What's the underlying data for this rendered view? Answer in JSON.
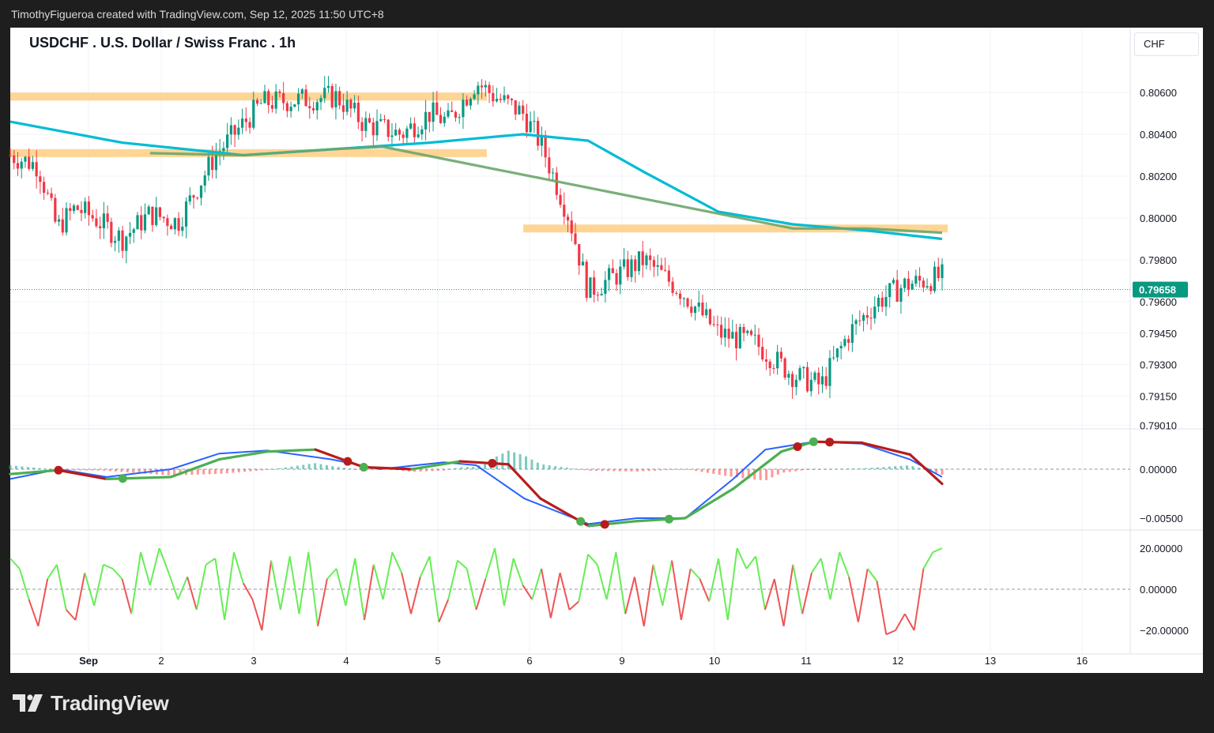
{
  "header": {
    "attribution": "TimothyFigueroa created with TradingView.com, Sep 12, 2025 11:50 UTC+8"
  },
  "chart_header": {
    "symbol_line": "USDCHF . U.S. Dollar / Swiss Franc . 1h",
    "currency_button": "CHF"
  },
  "footer": {
    "brand": "TradingView"
  },
  "colors": {
    "up": "#089981",
    "down": "#f23645",
    "ma_long": "#00bcd4",
    "ma_short": "#6aa66a",
    "zone": "#ffd08a",
    "macd": "#2962ff",
    "signal_up": "#4caf50",
    "signal_down": "#b71c1c",
    "osc_up": "#66ee55",
    "osc_down": "#ee5555"
  },
  "chart_data": [
    {
      "type": "candlestick",
      "title": "USDCHF . U.S. Dollar / Swiss Franc . 1h",
      "x_ticks": [
        "Sep",
        "2",
        "3",
        "4",
        "5",
        "6",
        "9",
        "10",
        "11",
        "12",
        "13",
        "16"
      ],
      "y_ticks": [
        "0.80600",
        "0.80400",
        "0.80200",
        "0.80000",
        "0.79800",
        "0.79600",
        "0.79450",
        "0.79300",
        "0.79150",
        "0.79010"
      ],
      "last_price": "0.79658",
      "close_path": [
        [
          0,
          0.803
        ],
        [
          0.03,
          0.8025
        ],
        [
          0.05,
          0.7995
        ],
        [
          0.07,
          0.8005
        ],
        [
          0.09,
          0.8
        ],
        [
          0.12,
          0.799
        ],
        [
          0.15,
          0.8002
        ],
        [
          0.18,
          0.7998
        ],
        [
          0.22,
          0.803
        ],
        [
          0.27,
          0.8055
        ],
        [
          0.35,
          0.8058
        ],
        [
          0.38,
          0.8045
        ],
        [
          0.42,
          0.804
        ],
        [
          0.45,
          0.805
        ],
        [
          0.47,
          0.8046
        ],
        [
          0.5,
          0.8065
        ],
        [
          0.52,
          0.8058
        ],
        [
          0.55,
          0.805
        ],
        [
          0.57,
          0.8035
        ],
        [
          0.6,
          0.8
        ],
        [
          0.62,
          0.7965
        ],
        [
          0.68,
          0.798
        ],
        [
          0.72,
          0.7965
        ],
        [
          0.76,
          0.7945
        ],
        [
          0.8,
          0.794
        ],
        [
          0.84,
          0.7925
        ],
        [
          0.87,
          0.792
        ],
        [
          0.9,
          0.7945
        ],
        [
          0.93,
          0.796
        ],
        [
          0.96,
          0.7968
        ],
        [
          1.0,
          0.7972
        ]
      ],
      "zones": [
        {
          "price": 0.8058,
          "from_x": "start",
          "to_x": "5"
        },
        {
          "price": 0.8031,
          "from_x": "start",
          "to_x": "5"
        },
        {
          "price": 0.7995,
          "from_x": "6",
          "to_x": "12"
        }
      ],
      "ma_long": [
        [
          0,
          0.8046
        ],
        [
          0.12,
          0.8036
        ],
        [
          0.25,
          0.803
        ],
        [
          0.35,
          0.8033
        ],
        [
          0.45,
          0.8036
        ],
        [
          0.55,
          0.804
        ],
        [
          0.62,
          0.8037
        ],
        [
          0.68,
          0.8022
        ],
        [
          0.76,
          0.8003
        ],
        [
          0.84,
          0.7997
        ],
        [
          0.92,
          0.7994
        ],
        [
          1.0,
          0.799
        ]
      ],
      "ma_short": [
        [
          0.15,
          0.8031
        ],
        [
          0.25,
          0.803
        ],
        [
          0.35,
          0.8033
        ],
        [
          0.4,
          0.8034
        ],
        [
          0.84,
          0.7995
        ],
        [
          0.92,
          0.7995
        ],
        [
          1.0,
          0.7993
        ]
      ]
    },
    {
      "type": "line",
      "y_ticks": [
        "0.00000",
        "-0.00500"
      ],
      "series": [
        {
          "key": "macd",
          "values": [
            [
              0,
              -0.001
            ],
            [
              0.06,
              0.0
            ],
            [
              0.12,
              -0.0008
            ],
            [
              0.2,
              0.0
            ],
            [
              0.26,
              0.0016
            ],
            [
              0.32,
              0.0019
            ],
            [
              0.4,
              0.001
            ],
            [
              0.46,
              0.0
            ],
            [
              0.54,
              0.0007
            ],
            [
              0.58,
              0.0004
            ],
            [
              0.64,
              -0.003
            ],
            [
              0.72,
              -0.0056
            ],
            [
              0.78,
              -0.005
            ],
            [
              0.84,
              -0.005
            ],
            [
              0.9,
              -0.001
            ],
            [
              0.94,
              0.002
            ],
            [
              1.0,
              0.0028
            ],
            [
              1.06,
              0.0026
            ],
            [
              1.12,
              0.001
            ],
            [
              1.16,
              -0.0008
            ]
          ]
        },
        {
          "key": "signal",
          "values": [
            [
              0,
              -0.0005
            ],
            [
              0.06,
              -0.0001
            ],
            [
              0.12,
              -0.001
            ],
            [
              0.2,
              -0.0008
            ],
            [
              0.26,
              0.001
            ],
            [
              0.32,
              0.0018
            ],
            [
              0.38,
              0.002
            ],
            [
              0.44,
              0.0002
            ],
            [
              0.5,
              0.0
            ],
            [
              0.56,
              0.0008
            ],
            [
              0.62,
              0.0005
            ],
            [
              0.66,
              -0.003
            ],
            [
              0.72,
              -0.0058
            ],
            [
              0.78,
              -0.0053
            ],
            [
              0.84,
              -0.005
            ],
            [
              0.9,
              -0.002
            ],
            [
              0.96,
              0.0018
            ],
            [
              1.0,
              0.0028
            ],
            [
              1.06,
              0.0027
            ],
            [
              1.12,
              0.0015
            ],
            [
              1.16,
              -0.0015
            ]
          ]
        }
      ]
    },
    {
      "type": "line",
      "y_ticks": [
        "20.00000",
        "0.00000",
        "-20.00000"
      ],
      "series": [
        {
          "key": "oscillator",
          "values": [
            [
              0,
              15
            ],
            [
              0.01,
              10
            ],
            [
              0.02,
              -5
            ],
            [
              0.03,
              -18
            ],
            [
              0.04,
              5
            ],
            [
              0.05,
              12
            ],
            [
              0.06,
              -10
            ],
            [
              0.07,
              -15
            ],
            [
              0.08,
              8
            ],
            [
              0.09,
              -8
            ],
            [
              0.1,
              12
            ],
            [
              0.11,
              10
            ],
            [
              0.12,
              5
            ],
            [
              0.13,
              -12
            ],
            [
              0.14,
              18
            ],
            [
              0.15,
              2
            ],
            [
              0.16,
              20
            ],
            [
              0.17,
              8
            ],
            [
              0.18,
              -5
            ],
            [
              0.19,
              6
            ],
            [
              0.2,
              -10
            ],
            [
              0.21,
              12
            ],
            [
              0.22,
              15
            ],
            [
              0.23,
              -15
            ],
            [
              0.24,
              18
            ],
            [
              0.25,
              3
            ],
            [
              0.26,
              -5
            ],
            [
              0.27,
              -20
            ],
            [
              0.28,
              14
            ],
            [
              0.29,
              -10
            ],
            [
              0.3,
              16
            ],
            [
              0.31,
              -12
            ],
            [
              0.32,
              18
            ],
            [
              0.33,
              -18
            ],
            [
              0.34,
              5
            ],
            [
              0.35,
              10
            ],
            [
              0.36,
              -8
            ],
            [
              0.37,
              15
            ],
            [
              0.38,
              -15
            ],
            [
              0.39,
              12
            ],
            [
              0.4,
              -5
            ],
            [
              0.41,
              18
            ],
            [
              0.42,
              8
            ],
            [
              0.43,
              -12
            ],
            [
              0.44,
              6
            ],
            [
              0.45,
              16
            ],
            [
              0.46,
              -16
            ],
            [
              0.47,
              -5
            ],
            [
              0.48,
              14
            ],
            [
              0.49,
              10
            ],
            [
              0.5,
              -10
            ],
            [
              0.51,
              5
            ],
            [
              0.52,
              20
            ],
            [
              0.53,
              -8
            ],
            [
              0.54,
              15
            ],
            [
              0.55,
              2
            ],
            [
              0.56,
              -5
            ],
            [
              0.57,
              10
            ],
            [
              0.58,
              -14
            ],
            [
              0.59,
              8
            ],
            [
              0.6,
              -10
            ],
            [
              0.61,
              -6
            ],
            [
              0.62,
              17
            ],
            [
              0.63,
              12
            ],
            [
              0.64,
              -5
            ],
            [
              0.65,
              18
            ],
            [
              0.66,
              -12
            ],
            [
              0.67,
              6
            ],
            [
              0.68,
              -18
            ],
            [
              0.69,
              12
            ],
            [
              0.7,
              -8
            ],
            [
              0.71,
              14
            ],
            [
              0.72,
              -15
            ],
            [
              0.73,
              10
            ],
            [
              0.74,
              5
            ],
            [
              0.75,
              -6
            ],
            [
              0.76,
              15
            ],
            [
              0.77,
              -15
            ],
            [
              0.78,
              20
            ],
            [
              0.79,
              10
            ],
            [
              0.8,
              16
            ],
            [
              0.81,
              -10
            ],
            [
              0.82,
              5
            ],
            [
              0.83,
              -18
            ],
            [
              0.84,
              12
            ],
            [
              0.85,
              -12
            ],
            [
              0.86,
              8
            ],
            [
              0.87,
              15
            ],
            [
              0.88,
              -5
            ],
            [
              0.89,
              18
            ],
            [
              0.9,
              6
            ],
            [
              0.91,
              -16
            ],
            [
              0.92,
              10
            ],
            [
              0.93,
              4
            ],
            [
              0.94,
              -22
            ],
            [
              0.95,
              -20
            ],
            [
              0.96,
              -12
            ],
            [
              0.97,
              -20
            ],
            [
              0.98,
              10
            ],
            [
              0.99,
              18
            ],
            [
              1.0,
              20
            ]
          ]
        }
      ]
    }
  ]
}
